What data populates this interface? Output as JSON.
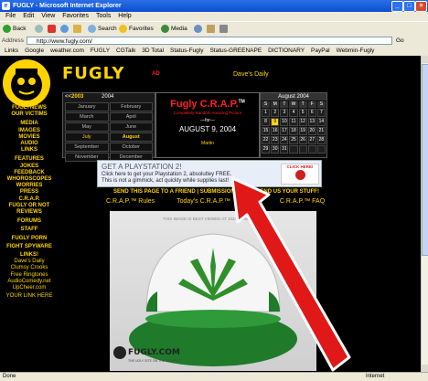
{
  "window": {
    "title": "FUGLY - Microsoft Internet Explorer",
    "min": "_",
    "max": "□",
    "close": "×"
  },
  "menu": [
    "File",
    "Edit",
    "View",
    "Favorites",
    "Tools",
    "Help"
  ],
  "toolbar": {
    "back": "Back",
    "search": "Search",
    "favorites": "Favorites",
    "media": "Media"
  },
  "address": {
    "label": "Address",
    "url": "http://www.fugly.com/",
    "go": "Go",
    "links_label": "Links"
  },
  "links": [
    "Google",
    "weather.com",
    "FUGLY",
    "CGTalk",
    "3D Total",
    "Status-Fugly",
    "Status-GREENAPE",
    "DICTIONARY",
    "PayPal",
    "Webmin-Fugly"
  ],
  "site": {
    "title": "FUGLY",
    "daves_daily": "Dave's Daily",
    "ad_tag": "AD",
    "nav_left": [
      "FUGLYNEWS",
      "OUR VICTIMS",
      "MEDIA",
      "IMAGES",
      "MOVIES",
      "AUDIO",
      "LINKS",
      "FEATURES",
      "JOKES",
      "FEEDBACK",
      "WHOROSCOPES",
      "WORRIES",
      "PRESS",
      "C.R.A.P.",
      "FUGLY OR NOT",
      "REVIEWS",
      "FORUMS",
      "STAFF",
      "FUGLY PORN",
      "FIGHT SPYWARE",
      "LINKS!",
      "Dave's Daily",
      "Clumsy Crooks",
      "Free Ringtones",
      "AudioComedy.net",
      "UpCheer.com",
      "YOUR LINK HERE"
    ],
    "calendar": {
      "prev": "<<",
      "year": "2003",
      "year2": "2004",
      "months": [
        "January",
        "February",
        "March",
        "April",
        "May",
        "June",
        "July",
        "August",
        "September",
        "October",
        "November",
        "December"
      ]
    },
    "crap": {
      "title": "Fugly C.R.A.P.",
      "tm": "TM",
      "subtitle": "Completely Random Amazing Picture",
      "for": "—for—",
      "date": "AUGUST 9, 2004",
      "by": "Martin"
    },
    "month_cal": {
      "title": "August 2004",
      "days": [
        "S",
        "M",
        "T",
        "W",
        "T",
        "F",
        "S"
      ],
      "rows": [
        [
          "1",
          "2",
          "3",
          "4",
          "5",
          "6",
          "7"
        ],
        [
          "8",
          "9",
          "10",
          "11",
          "12",
          "13",
          "14"
        ],
        [
          "15",
          "16",
          "17",
          "18",
          "19",
          "20",
          "21"
        ],
        [
          "22",
          "23",
          "24",
          "25",
          "26",
          "27",
          "28"
        ],
        [
          "29",
          "30",
          "31",
          "",
          "",
          "",
          ""
        ]
      ]
    },
    "ad": {
      "line1": "GET A PLAYSTATION 2!",
      "line2": "Click here to get your Playstation 2, absolutley FREE.",
      "line3": "This is not a gimmick, act quickly while supplies last!",
      "button": "CLICK HERE!"
    },
    "send_bar": {
      "left": "SEND THIS PAGE TO A FRIEND",
      "sep": "|",
      "mid": "SUBMISSIONS",
      "right": "SEND US YOUR STUFF!"
    },
    "sub_links": [
      "C.R.A.P.™ Rules",
      "Today's C.R.A.P.™",
      "C.R.A.P.™ FAQ"
    ],
    "image_caption": "THIS IMAGE IS BEST VIEWED AT 1024 X 768",
    "watermark": "FUGLY.COM",
    "watermark_sub": "THE UGLY SITE ON THE INTERNET"
  },
  "status": {
    "text": "Done",
    "zone": "Internet"
  },
  "colors": {
    "accent": "#ffd400",
    "crap_red": "#ff2020",
    "ad_red": "#cc2020",
    "hat_green": "#1f7a2a"
  }
}
